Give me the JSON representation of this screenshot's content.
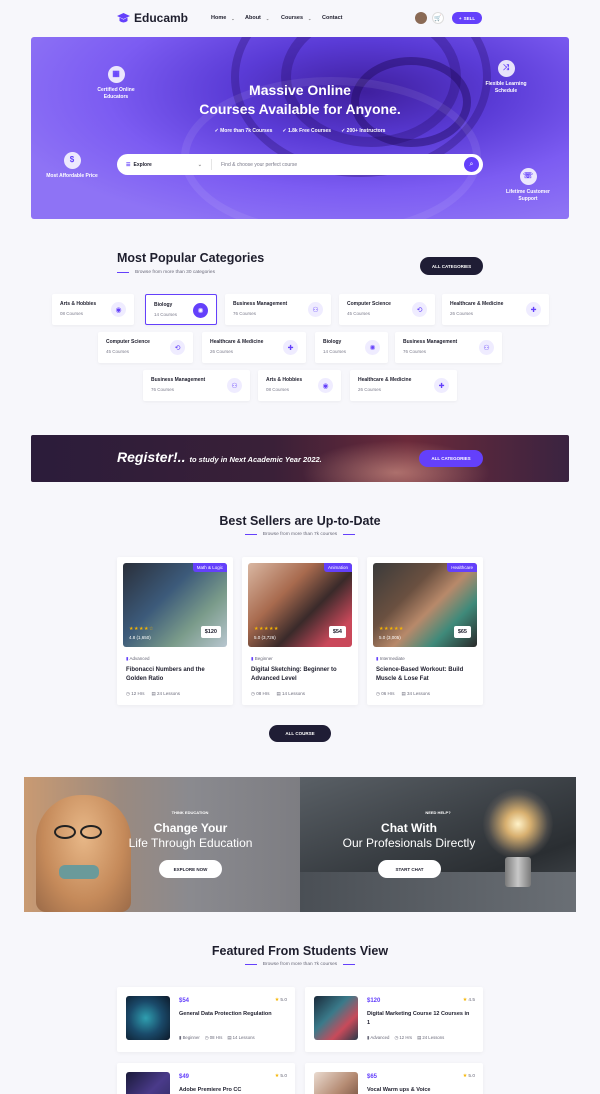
{
  "header": {
    "brand": "Educamb",
    "nav": [
      {
        "label": "Home",
        "dropdown": true
      },
      {
        "label": "About",
        "dropdown": true
      },
      {
        "label": "Courses",
        "dropdown": true
      },
      {
        "label": "Contact",
        "dropdown": false
      }
    ],
    "sell_label": "SELL",
    "accent": "#6440fb"
  },
  "hero": {
    "title_line1": "Massive Online",
    "title_line2": "Courses Available for Anyone.",
    "checks": [
      "More than 7k Courses",
      "1.8k Free Courses",
      "200+ Instructors"
    ],
    "search": {
      "category": "Explore",
      "placeholder": "Find & choose your perfect course"
    },
    "features": {
      "certified": "Certified Online Educators",
      "flexible": "Flexible Learning Schedule",
      "affordable": "Most Affordable Price",
      "support": "Lifetime Customer Support"
    }
  },
  "categories": {
    "title": "Most Popular Categories",
    "subtitle": "Browse from more than 30 categories",
    "button": "ALL CATEGORIES",
    "items": [
      {
        "name": "Arts & Hobbies",
        "count": "08 Courses",
        "icon": "palette-icon"
      },
      {
        "name": "Biology",
        "count": "14 Courses",
        "icon": "atom-icon"
      },
      {
        "name": "Business Management",
        "count": "76 Courses",
        "icon": "network-icon"
      },
      {
        "name": "Computer Science",
        "count": "45 Courses",
        "icon": "code-icon"
      },
      {
        "name": "Healthcare & Medicine",
        "count": "26 Courses",
        "icon": "medical-icon"
      },
      {
        "name": "Computer Science",
        "count": "45 Courses",
        "icon": "code-icon"
      },
      {
        "name": "Healthcare & Medicine",
        "count": "26 Courses",
        "icon": "medical-icon"
      },
      {
        "name": "Biology",
        "count": "14 Courses",
        "icon": "atom-icon"
      },
      {
        "name": "Business Management",
        "count": "76 Courses",
        "icon": "network-icon"
      },
      {
        "name": "Business Management",
        "count": "76 Courses",
        "icon": "network-icon"
      },
      {
        "name": "Arts & Hobbies",
        "count": "08 Courses",
        "icon": "palette-icon"
      },
      {
        "name": "Healthcare & Medicine",
        "count": "26 Courses",
        "icon": "medical-icon"
      }
    ]
  },
  "register": {
    "headline": "Register!..",
    "text": "to study in Next Academic Year 2022.",
    "button": "ALL CATEGORIES"
  },
  "bestsellers": {
    "title": "Best Sellers are Up-to-Date",
    "subtitle": "Browse from more than 7k courses",
    "button": "ALL COURSE",
    "courses": [
      {
        "tag": "Math & Logic",
        "stars": "★★★★☆",
        "rating": "4.8 (1,650)",
        "price": "$120",
        "level": "Advanced",
        "title": "Fibonacci Numbers and the Golden Ratio",
        "hours": "12 Hrs",
        "lessons": "24 Lessons"
      },
      {
        "tag": "Animation",
        "stars": "★★★★★",
        "rating": "5.0 (3,726)",
        "price": "$54",
        "level": "Beginner",
        "title": "Digital Sketching: Beginner to Advanced Level",
        "hours": "08 Hrs",
        "lessons": "14 Lessons"
      },
      {
        "tag": "Healthcare",
        "stars": "★★★★★",
        "rating": "5.0 (3,005)",
        "price": "$65",
        "level": "Intermediate",
        "title": "Science-Based Workout: Build Muscle & Lose Fat",
        "hours": "06 Hrs",
        "lessons": "34 Lessons"
      }
    ]
  },
  "promo": {
    "left": {
      "kicker": "THINK EDUCATION",
      "title": "Change Your",
      "subtitle": "Life Through Education",
      "button": "EXPLORE NOW"
    },
    "right": {
      "kicker": "NEED HELP?",
      "title": "Chat With",
      "subtitle": "Our Profesionals Directly",
      "button": "START CHAT"
    }
  },
  "featured": {
    "title": "Featured From Students View",
    "subtitle": "Browse from more than 7k courses",
    "items": [
      {
        "price": "$54",
        "rating": "5.0",
        "title": "General Data Protection Regulation",
        "level": "Beginner",
        "hours": "08 Hrs",
        "lessons": "14 Lessons"
      },
      {
        "price": "$120",
        "rating": "4.5",
        "title": "Digital Marketing Course 12 Courses in 1",
        "level": "Advanced",
        "hours": "12 Hrs",
        "lessons": "24 Lessons"
      },
      {
        "price": "$49",
        "rating": "5.0",
        "title": "Adobe Premiere Pro CC"
      },
      {
        "price": "$65",
        "rating": "5.0",
        "title": "Vocal Warm ups & Voice"
      }
    ]
  }
}
